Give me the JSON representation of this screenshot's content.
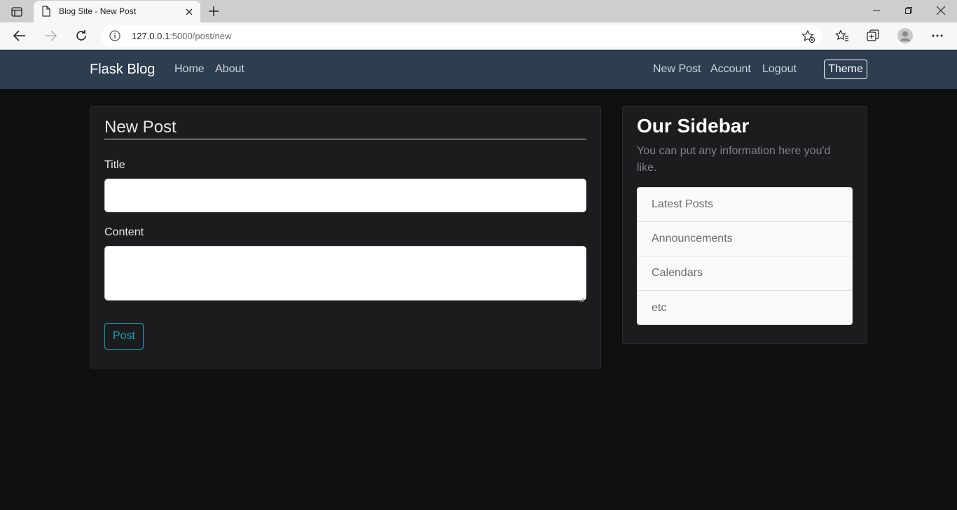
{
  "browser": {
    "tab_title": "Blog Site - New Post",
    "url_host": "127.0.0.1",
    "url_rest": ":5000/post/new"
  },
  "navbar": {
    "brand": "Flask Blog",
    "left_links": [
      "Home",
      "About"
    ],
    "right_links": [
      "New Post",
      "Account",
      "Logout"
    ],
    "theme_button": "Theme"
  },
  "form": {
    "legend": "New Post",
    "title_label": "Title",
    "title_value": "",
    "content_label": "Content",
    "content_value": "",
    "submit_label": "Post"
  },
  "sidebar": {
    "title": "Our Sidebar",
    "description": "You can put any information here you'd like.",
    "items": [
      "Latest Posts",
      "Announcements",
      "Calendars",
      "etc"
    ]
  },
  "colors": {
    "navbar_bg": "#2c3e50",
    "page_bg": "#0f0f10",
    "card_bg": "#1c1c1e",
    "accent": "#17a2b8"
  }
}
